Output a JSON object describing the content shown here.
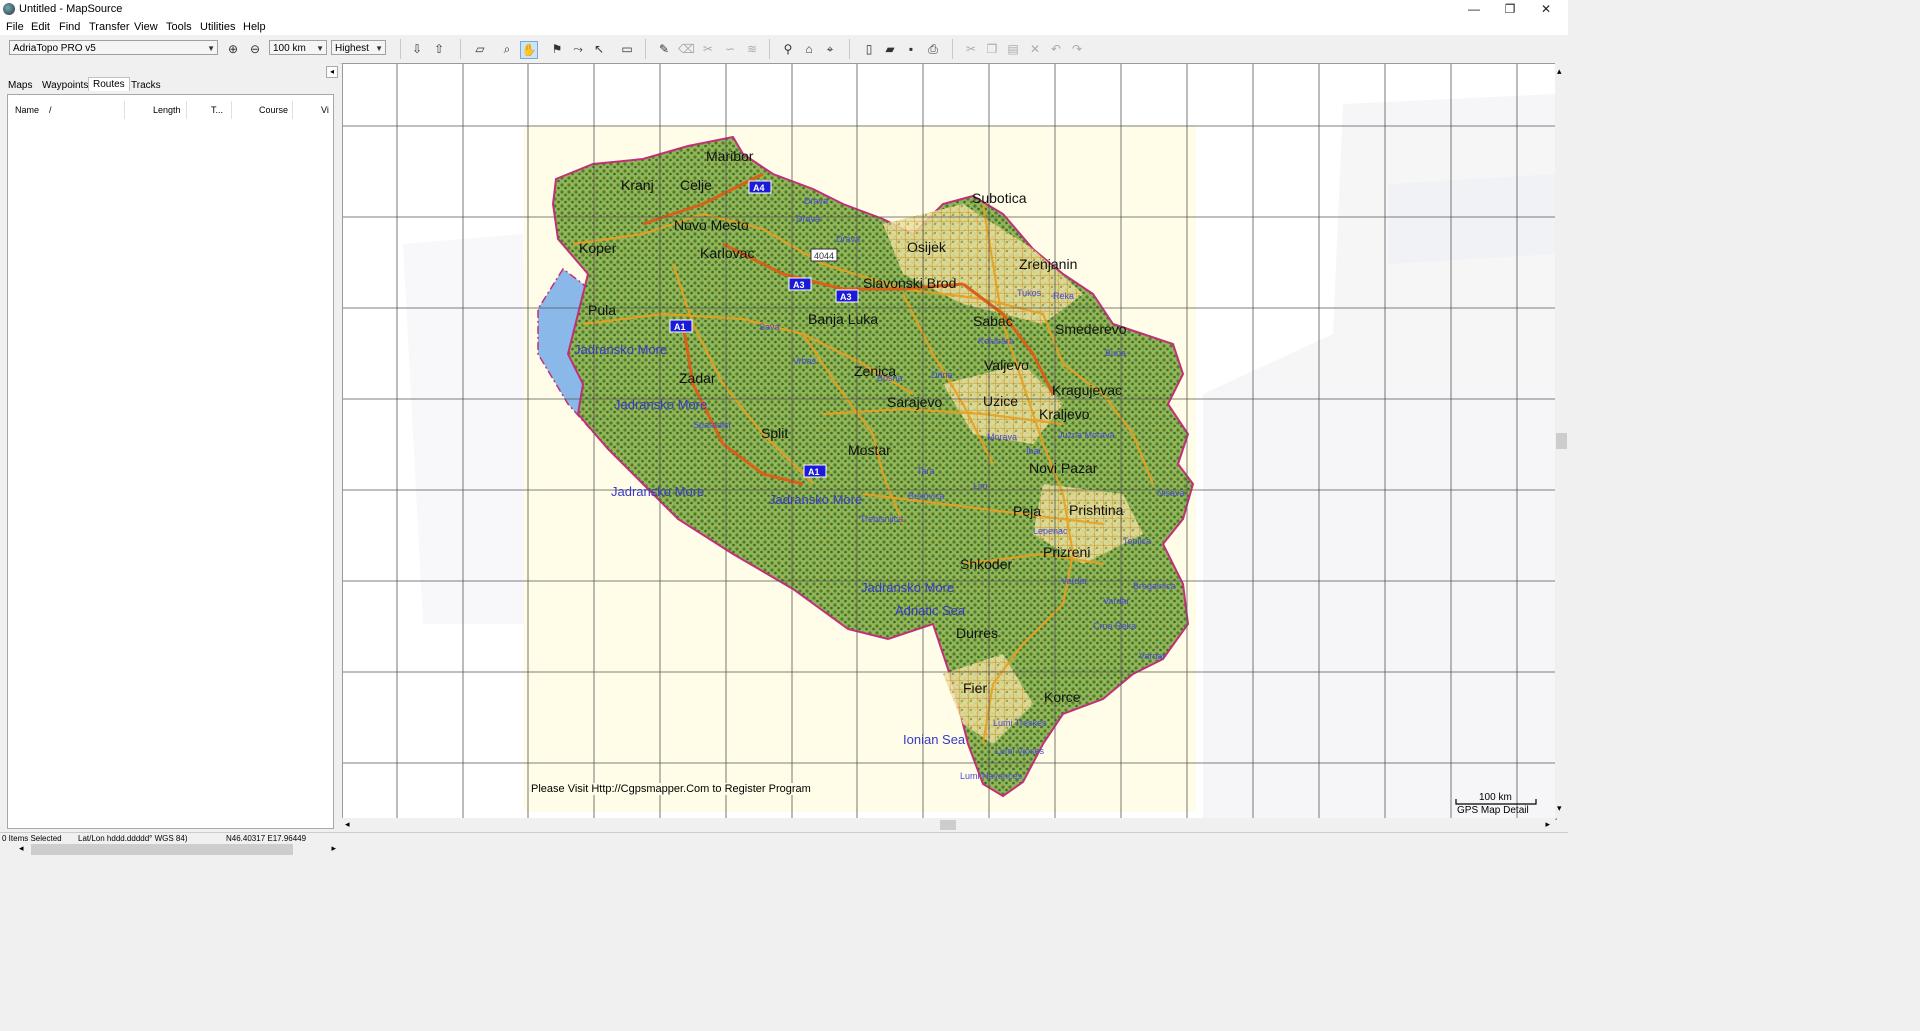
{
  "window": {
    "title": "Untitled - MapSource",
    "minimize": "—",
    "maximize": "❐",
    "close": "✕"
  },
  "menu": [
    "File",
    "Edit",
    "Find",
    "Transfer",
    "View",
    "Tools",
    "Utilities",
    "Help"
  ],
  "toolbar": {
    "map_product": "AdriaTopo PRO v5",
    "zoom_scale": "100 km",
    "detail_level": "Highest"
  },
  "left_panel": {
    "tabs": [
      "Maps",
      "Waypoints",
      "Routes",
      "Tracks"
    ],
    "active_tab": "Routes",
    "columns": [
      "Name",
      "/",
      "Length",
      "T...",
      "Course",
      "Vi"
    ],
    "collapse_glyph": "◂"
  },
  "map": {
    "cities": [
      "Maribor",
      "Kranj",
      "Celje",
      "Novo Mesto",
      "Koper",
      "Karlovac",
      "Pula",
      "Zadar",
      "Split",
      "Subotica",
      "Osijek",
      "Zrenjanin",
      "Slavonski Brod",
      "Banja Luka",
      "Sabac",
      "Smederevo",
      "Valjevo",
      "Zenica",
      "Sarajevo",
      "Uzice",
      "Kragujevac",
      "Kraljevo",
      "Mostar",
      "Novi Pazar",
      "Peja",
      "Prishtina",
      "Prizreni",
      "Shkoder",
      "Durres",
      "Fier",
      "Korce"
    ],
    "seas": [
      "Jadransko More",
      "Jadransko More",
      "Jadransko More",
      "Jadransko More",
      "Jadransko More",
      "Adriatic Sea",
      "Ionian Sea"
    ],
    "minor_labels": [
      "Drava",
      "Drava",
      "Drava",
      "Sava",
      "Vrbas",
      "Bosna",
      "Drina",
      "Morava",
      "Lim",
      "Tara",
      "Tukos",
      "Reka",
      "Kolubara",
      "Ibar",
      "Sparadici",
      "Trebisnjica",
      "Bukovica",
      "Buna",
      "Vardar",
      "Vardar",
      "Vardar",
      "Bregalnica",
      "Crna Reka",
      "Lumi Treskes",
      "Lumi Vjoses",
      "Lumi Navances",
      "Nisava",
      "Toplica",
      "Juzna Morava",
      "Lepenac"
    ],
    "highways": [
      "A4",
      "A3",
      "A3",
      "A1",
      "A1"
    ],
    "road_number": "4044",
    "footer_note": "Please Visit Http://Cgpsmapper.Com to Register Program",
    "scale_label": "100 km",
    "detail_label": "GPS Map Detail",
    "colors": {
      "sea": "#8ab8e8",
      "land_bg": "#fffde7",
      "forest": "#5e8f3c",
      "road": "#e8a020",
      "motorway": "#d86018",
      "border": "#c0307a",
      "grid": "#555555"
    }
  },
  "statusbar": {
    "selection": "0 Items Selected",
    "format": "Lat/Lon hddd.ddddd° WGS 84)",
    "position": "N46.40317 E17.96449"
  }
}
